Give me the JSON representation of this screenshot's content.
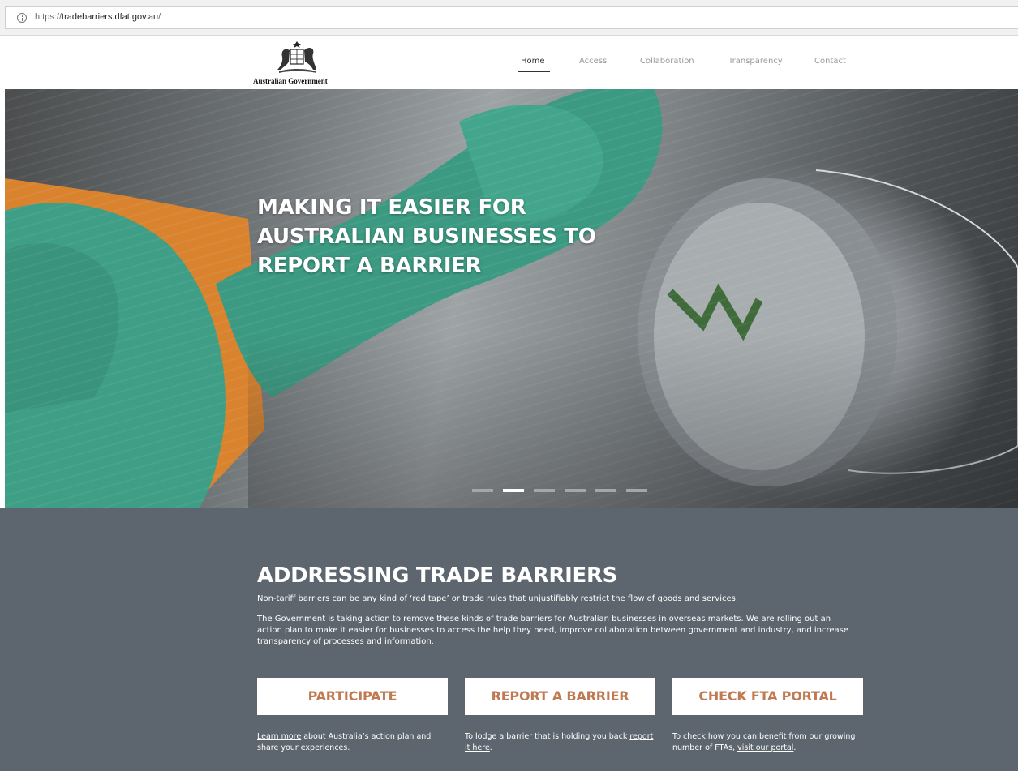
{
  "browser": {
    "url_scheme": "https://",
    "url_host": "tradebarriers.dfat.gov.au",
    "url_path": "/"
  },
  "header": {
    "logo_text": "Australian Government",
    "nav": [
      {
        "label": "Home",
        "active": true
      },
      {
        "label": "Access",
        "active": false
      },
      {
        "label": "Collaboration",
        "active": false
      },
      {
        "label": "Transparency",
        "active": false
      },
      {
        "label": "Contact",
        "active": false
      }
    ]
  },
  "hero": {
    "title": "MAKING IT EASIER FOR AUSTRALIAN BUSINESSES TO REPORT A BARRIER",
    "slide_count": 6,
    "active_slide": 2
  },
  "section": {
    "title": "ADDRESSING TRADE BARRIERS",
    "paragraph_1": "Non-tariff barriers can be any kind of ‘red tape’ or trade rules that unjustifiably restrict the flow of goods and services.",
    "paragraph_2": "The Government is taking action to remove these kinds of trade barriers for Australian businesses in overseas markets. We are rolling out an action plan to make it easier for businesses to access the help they need, improve collaboration between government and industry, and increase transparency of processes and information."
  },
  "ctas": [
    {
      "label": "PARTICIPATE",
      "desc_link": "Learn more",
      "desc_rest": " about Australia’s action plan and share your experiences."
    },
    {
      "label": "REPORT A BARRIER",
      "desc_pre": "To lodge a barrier that is holding you back ",
      "desc_link": "report it here",
      "desc_post": "."
    },
    {
      "label": "CHECK FTA PORTAL",
      "desc_pre": "To check how you can benefit from our growing number of FTAs, ",
      "desc_link": "visit our portal",
      "desc_post": "."
    }
  ],
  "colors": {
    "section_bg": "#5d666e",
    "cta_text": "#c07a52"
  }
}
